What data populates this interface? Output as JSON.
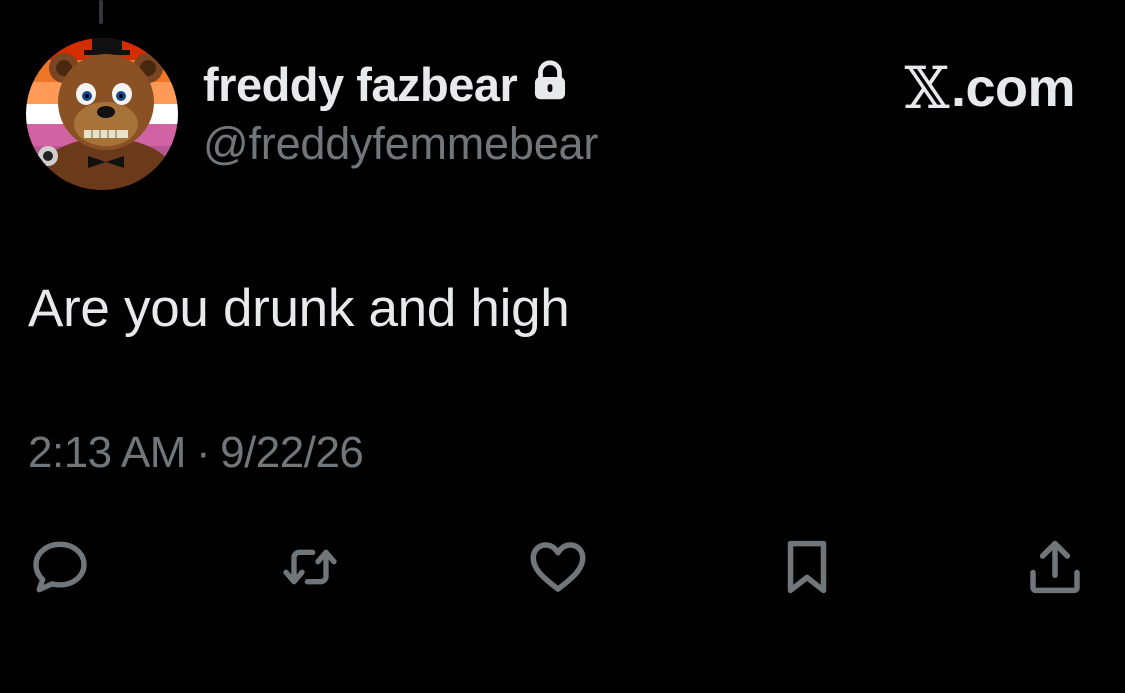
{
  "author": {
    "display_name": "freddy fazbear",
    "handle": "@freddyfemmebear",
    "protected": true,
    "avatar_icon": "freddy-fazbear-avatar-lesbian-flag"
  },
  "brand": {
    "x_letter": "𝕏",
    "suffix": ".com"
  },
  "tweet": {
    "text": "Are you drunk and high",
    "time": "2:13 AM",
    "separator": "·",
    "date": "9/22/26"
  },
  "actions": [
    {
      "name": "reply",
      "icon": "speech-bubble-icon"
    },
    {
      "name": "repost",
      "icon": "repost-icon"
    },
    {
      "name": "like",
      "icon": "heart-icon"
    },
    {
      "name": "bookmark",
      "icon": "bookmark-icon"
    },
    {
      "name": "share",
      "icon": "share-icon"
    }
  ],
  "colors": {
    "background": "#000000",
    "primary_text": "#e7e9ea",
    "secondary_text": "#71767b",
    "flag": [
      "#d52d00",
      "#ef7627",
      "#ff9a56",
      "#ffffff",
      "#d162a4",
      "#b55690",
      "#a30262"
    ]
  }
}
